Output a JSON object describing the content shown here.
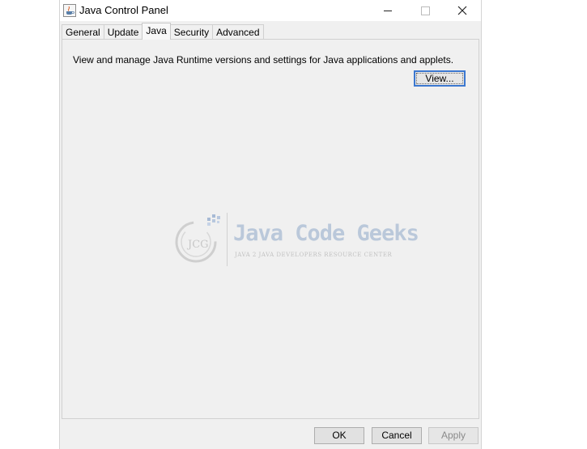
{
  "window": {
    "title": "Java Control Panel",
    "icon": "java-cup-icon"
  },
  "tabs": [
    {
      "label": "General",
      "active": false
    },
    {
      "label": "Update",
      "active": false
    },
    {
      "label": "Java",
      "active": true
    },
    {
      "label": "Security",
      "active": false
    },
    {
      "label": "Advanced",
      "active": false
    }
  ],
  "java_tab": {
    "description": "View and manage Java Runtime versions and settings for Java applications and applets.",
    "view_button": "View..."
  },
  "watermark": {
    "brand": "Java Code Geeks",
    "tagline": "JAVA 2 JAVA DEVELOPERS RESOURCE CENTER",
    "logo_text": "JCG"
  },
  "buttons": {
    "ok": "OK",
    "cancel": "Cancel",
    "apply": "Apply"
  }
}
